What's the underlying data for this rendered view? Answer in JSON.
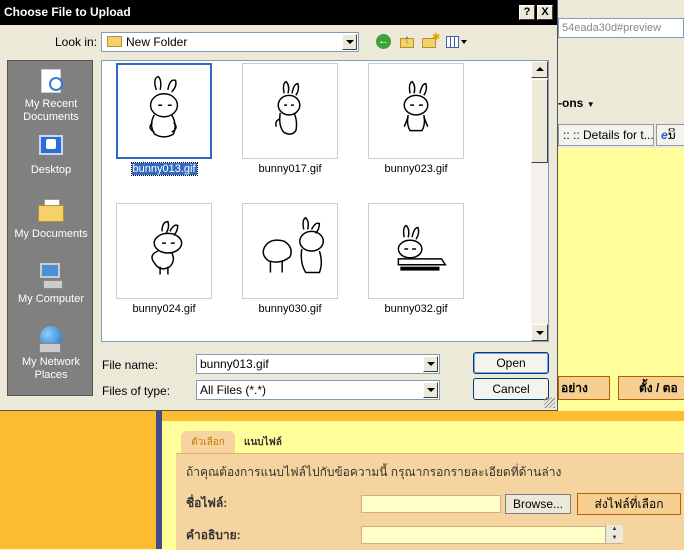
{
  "dialog": {
    "title": "Choose File to Upload",
    "help_label": "?",
    "close_label": "X",
    "look_in_label": "Look in:",
    "look_in_value": "New Folder",
    "places": [
      {
        "label": "My Recent Documents",
        "icon": "recent-documents-icon"
      },
      {
        "label": "Desktop",
        "icon": "desktop-icon"
      },
      {
        "label": "My Documents",
        "icon": "my-documents-icon"
      },
      {
        "label": "My Computer",
        "icon": "my-computer-icon"
      },
      {
        "label": "My Network Places",
        "icon": "network-places-icon"
      }
    ],
    "files": [
      {
        "name": "bunny013.gif",
        "selected": true
      },
      {
        "name": "bunny017.gif",
        "selected": false
      },
      {
        "name": "bunny023.gif",
        "selected": false
      },
      {
        "name": "bunny024.gif",
        "selected": false
      },
      {
        "name": "bunny030.gif",
        "selected": false
      },
      {
        "name": "bunny032.gif",
        "selected": false
      }
    ],
    "file_name_label": "File name:",
    "file_name_value": "bunny013.gif",
    "files_of_type_label": "Files of type:",
    "files_of_type_value": "All Files (*.*)",
    "open_label": "Open",
    "cancel_label": "Cancel"
  },
  "background": {
    "url_fragment": "54eada30d#preview",
    "menu_label": "-ons",
    "tab1_label": ":: :: Details for t...",
    "tab2_label": "ນິ",
    "btn1_label": "อย่าง",
    "btn2_label": "ตั้ง / ตอ",
    "attach_tab_options": "ตัวเลือก",
    "attach_tab_files": "แนบไฟล์",
    "attach_description": "ถ้าคุณต้องการแนบไฟล์ไปกับข้อความนี้ กรุณากรอกรายละเอียดที่ด้านล่าง",
    "file_name_label": "ชื่อไฟล์:",
    "browse_label": "Browse...",
    "send_file_label": "ส่งไฟล์ที่เลือก",
    "description_label": "คำอธิบาย:"
  },
  "colors": {
    "selection": "#316ac5",
    "page_yellow": "#fffe9b",
    "page_orange": "#fbbc2f",
    "panel_peach": "#f6d4a0"
  }
}
